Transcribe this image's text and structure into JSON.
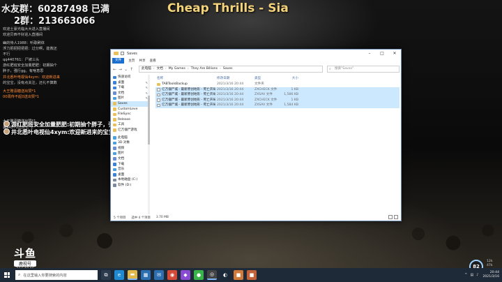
{
  "stream": {
    "group1": "水友群：60287498 已满",
    "group2": "2群：213663066",
    "song_title": "Cheap Thrills - Sia",
    "chat": [
      {
        "text": "欢迎土豪光临大大进入直播间",
        "color": "gray"
      },
      {
        "text": "欢迎贝西不好进入直播间",
        "color": "gray"
      },
      {
        "text": "",
        "color": "spacer"
      },
      {
        "text": "幽的侍人1988：听歌刷体",
        "color": "gray"
      },
      {
        "text": "浮力把把把把把：过分啊，能救还",
        "color": "gray"
      },
      {
        "text": "不行",
        "color": "gray"
      },
      {
        "text": "qq440761：尸被三头",
        "color": "gray"
      },
      {
        "text": "游红肥班安全加量肥肥：初期抽个",
        "color": "gray"
      },
      {
        "text": "胖子，强行gg。有啥意思",
        "color": "gray"
      },
      {
        "text": "井北悉叶电视仙4xym：欢迎新进来",
        "color": "orange"
      },
      {
        "text": "的宝宝，没有点关注，还礼不算数",
        "color": "gray"
      },
      {
        "text": "",
        "color": "spacer"
      },
      {
        "text": "大王赠喜糖送出赞*1",
        "color": "orange"
      },
      {
        "text": "00周传不起0送出赞*1",
        "color": "orange"
      }
    ],
    "chat2": [
      {
        "text": "大王赠喜糖送出赞*1",
        "color": "orange"
      },
      {
        "text": "",
        "color": "spacer"
      },
      {
        "text": "",
        "color": "spacer"
      },
      {
        "text": "暑44276送出赞*1",
        "color": "orange"
      }
    ],
    "danmaku": [
      "游红肥班安全加量肥肥:初期抽个胖子，强行",
      "井北悉叶电视仙4xym:欢迎新进来的宝宝，没有点关注"
    ],
    "logo": {
      "big": "斗鱼",
      "sub": "鹿视号",
      "num": "7164946"
    },
    "stat_value": "82",
    "net_up": "12k",
    "net_down": "47k"
  },
  "explorer": {
    "title": "Saves",
    "ribbon_tabs": [
      "文件",
      "主页",
      "共享",
      "查看"
    ],
    "breadcrumb": [
      "此电脑",
      "文档",
      "My Games",
      "They Are Billions",
      "Saves"
    ],
    "search_placeholder": "搜索\"Saves\"",
    "nav_items": [
      {
        "label": "快速访问",
        "icon": "star-icon",
        "color": "#3b82d6",
        "pin": false,
        "selected": false
      },
      {
        "label": "桌面",
        "icon": "desktop-icon",
        "color": "#3b82d6",
        "pin": true,
        "selected": false
      },
      {
        "label": "下载",
        "icon": "download-icon",
        "color": "#3b82d6",
        "pin": true,
        "selected": false
      },
      {
        "label": "文档",
        "icon": "document-icon",
        "color": "#6a8fd0",
        "pin": true,
        "selected": false
      },
      {
        "label": "图片",
        "icon": "picture-icon",
        "color": "#4aa0e0",
        "pin": true,
        "selected": false
      },
      {
        "label": "Saves",
        "icon": "folder-icon",
        "color": "#e8c15c",
        "pin": false,
        "selected": true
      },
      {
        "label": "CustomLeve",
        "icon": "folder-icon",
        "color": "#e8c15c",
        "pin": false,
        "selected": false
      },
      {
        "label": "FileSync",
        "icon": "folder-icon",
        "color": "#e8c15c",
        "pin": false,
        "selected": false
      },
      {
        "label": "Release",
        "icon": "folder-icon",
        "color": "#e8c15c",
        "pin": false,
        "selected": false
      },
      {
        "label": "工具",
        "icon": "folder-icon",
        "color": "#e8c15c",
        "pin": false,
        "selected": false
      },
      {
        "label": "亿万僵尸游戏",
        "icon": "folder-icon",
        "color": "#e8c15c",
        "pin": false,
        "selected": false
      },
      {
        "label": "",
        "icon": "gap",
        "color": "",
        "pin": false,
        "selected": false
      },
      {
        "label": "此电脑",
        "icon": "computer-icon",
        "color": "#4aa0e0",
        "pin": false,
        "selected": false
      },
      {
        "label": "3D 对象",
        "icon": "cube-icon",
        "color": "#4aa0e0",
        "pin": false,
        "selected": false
      },
      {
        "label": "视频",
        "icon": "video-icon",
        "color": "#6a8fd0",
        "pin": false,
        "selected": false
      },
      {
        "label": "图片",
        "icon": "picture-icon",
        "color": "#4aa0e0",
        "pin": false,
        "selected": false
      },
      {
        "label": "文档",
        "icon": "document-icon",
        "color": "#6a8fd0",
        "pin": false,
        "selected": false
      },
      {
        "label": "下载",
        "icon": "download-icon",
        "color": "#3b82d6",
        "pin": false,
        "selected": false
      },
      {
        "label": "音乐",
        "icon": "music-icon",
        "color": "#4aa0e0",
        "pin": false,
        "selected": false
      },
      {
        "label": "桌面",
        "icon": "desktop-icon",
        "color": "#3b82d6",
        "pin": false,
        "selected": false
      },
      {
        "label": "本地磁盘 (C:)",
        "icon": "drive-icon",
        "color": "#7a8a9a",
        "pin": false,
        "selected": false
      },
      {
        "label": "软件 (D:)",
        "icon": "drive-icon",
        "color": "#7a8a9a",
        "pin": false,
        "selected": false
      }
    ],
    "columns": {
      "name": "名称",
      "date": "修改日期",
      "type": "类型",
      "size": "大小"
    },
    "files": [
      {
        "name": "TABToolsBackup",
        "date": "2021/3/16 20:44",
        "type": "文件夹",
        "size": "",
        "kind": "folder",
        "selected": false
      },
      {
        "name": "亿万僵尸城 - 最新原创地形 - 死亡开局.zxcheck",
        "date": "2021/3/16 20:44",
        "type": "ZXCHECK 文件",
        "size": "1 KB",
        "kind": "file",
        "selected": true
      },
      {
        "name": "亿万僵尸城 - 最新原创地形 - 死亡开局.zxsav",
        "date": "2021/3/16 20:44",
        "type": "ZXSAV 文件",
        "size": "1,586 KB",
        "kind": "file",
        "selected": true
      },
      {
        "name": "亿万僵尸城 - 最新原创地形 - 死亡开局_Backu...",
        "date": "2021/3/16 20:44",
        "type": "ZXCHECK 文件",
        "size": "1 KB",
        "kind": "file",
        "selected": true
      },
      {
        "name": "亿万僵尸城 - 最新原创地形 - 死亡开局_Backu...",
        "date": "2021/3/16 20:44",
        "type": "ZXSAV 文件",
        "size": "1,584 KB",
        "kind": "file",
        "selected": true
      }
    ],
    "status": {
      "count": "5 个项目",
      "selected": "选中 4 个项目",
      "size": "3.70 MB"
    }
  },
  "taskbar": {
    "search_placeholder": "在这里输入你要搜索的内容",
    "apps": [
      {
        "name": "task-view-icon",
        "glyph": "⧉",
        "color": "#2b3a4d",
        "active": false
      },
      {
        "name": "edge-icon",
        "glyph": "e",
        "color": "#1f8ad2",
        "active": false
      },
      {
        "name": "explorer-icon",
        "glyph": "▬",
        "color": "#e0b84a",
        "active": true
      },
      {
        "name": "store-icon",
        "glyph": "▦",
        "color": "#2b6fb0",
        "active": false
      },
      {
        "name": "mail-icon",
        "glyph": "✉",
        "color": "#2b6fb0",
        "active": false
      },
      {
        "name": "browser-icon",
        "glyph": "◉",
        "color": "#d24a3a",
        "active": false
      },
      {
        "name": "game-icon",
        "glyph": "◆",
        "color": "#8a4ad2",
        "active": false
      },
      {
        "name": "chat-icon",
        "glyph": "●",
        "color": "#3ab44a",
        "active": false
      },
      {
        "name": "obs-icon",
        "glyph": "◎",
        "color": "#444444",
        "active": true
      },
      {
        "name": "steam-icon",
        "glyph": "◐",
        "color": "#1b2838",
        "active": false
      },
      {
        "name": "app-icon-1",
        "glyph": "■",
        "color": "#d27a3a",
        "active": false
      },
      {
        "name": "app-icon-2",
        "glyph": "■",
        "color": "#c2623a",
        "active": false
      }
    ],
    "time": "20:44",
    "date": "2021/3/16"
  }
}
